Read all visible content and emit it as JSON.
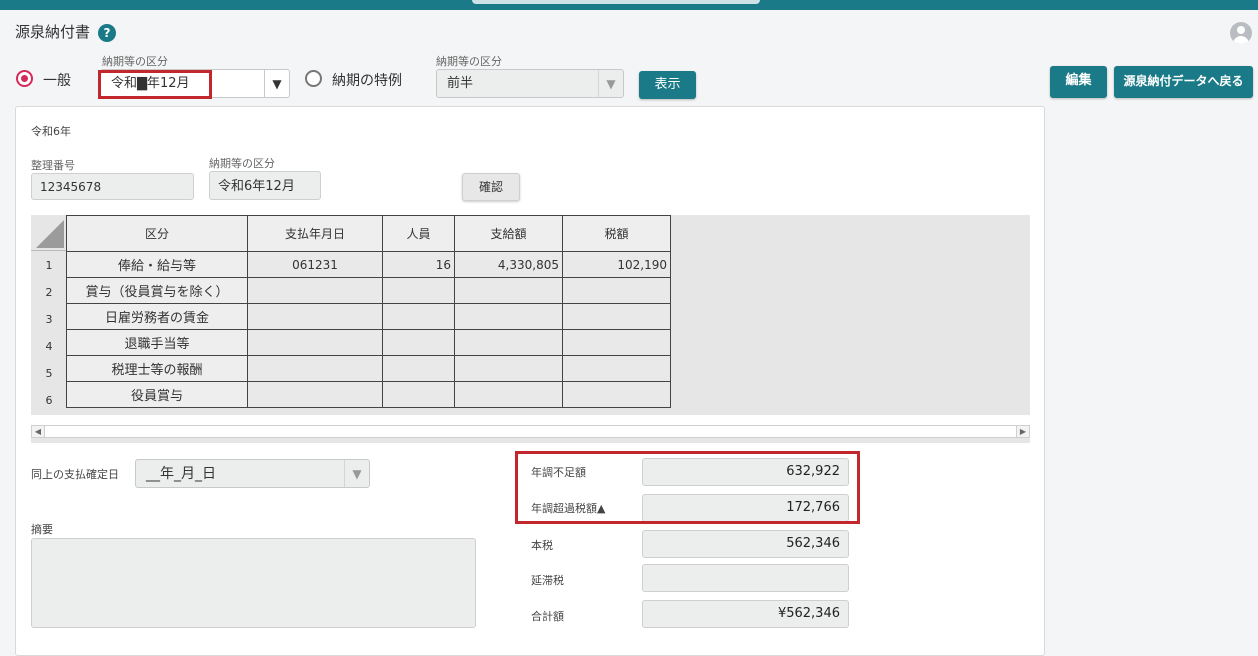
{
  "header": {
    "title": "源泉納付書",
    "help_symbol": "?",
    "user_icon": "user-avatar-icon"
  },
  "filter": {
    "period_label": "納期等の区分",
    "general_label": "一般",
    "general_selected": true,
    "period_value": "令和▇年12月",
    "special_label": "納期の特例",
    "special_selected": false,
    "special_period_label": "納期等の区分",
    "special_period_value": "前半",
    "show_button": "表示"
  },
  "actions": {
    "edit_button": "編集",
    "back_button": "源泉納付データへ戻る"
  },
  "form": {
    "year_heading": "令和6年",
    "ref_label": "整理番号",
    "ref_value": "12345678",
    "period_label": "納期等の区分",
    "period_value": "令和6年12月",
    "confirm_button": "確認"
  },
  "table": {
    "headers": [
      "区分",
      "支払年月日",
      "人員",
      "支給額",
      "税額"
    ],
    "rows": [
      {
        "no": "1",
        "category": "俸給・給与等",
        "date": "061231",
        "people": "16",
        "amount": "4,330,805",
        "tax": "102,190"
      },
      {
        "no": "2",
        "category": "賞与（役員賞与を除く）",
        "date": "",
        "people": "",
        "amount": "",
        "tax": ""
      },
      {
        "no": "3",
        "category": "日雇労務者の賃金",
        "date": "",
        "people": "",
        "amount": "",
        "tax": ""
      },
      {
        "no": "4",
        "category": "退職手当等",
        "date": "",
        "people": "",
        "amount": "",
        "tax": ""
      },
      {
        "no": "5",
        "category": "税理士等の報酬",
        "date": "",
        "people": "",
        "amount": "",
        "tax": ""
      },
      {
        "no": "6",
        "category": "役員賞与",
        "date": "",
        "people": "",
        "amount": "",
        "tax": ""
      }
    ]
  },
  "bottom": {
    "pay_date_label": "同上の支払確定日",
    "pay_date_value": "__年_月_日",
    "memo_label": "摘要",
    "shortage_label": "年調不足額",
    "shortage_value": "632,922",
    "excess_label": "年調超過税額▲",
    "excess_value": "172,766",
    "main_tax_label": "本税",
    "main_tax_value": "562,346",
    "delinquent_label": "延滞税",
    "delinquent_value": "",
    "total_label": "合計額",
    "total_value": "¥562,346"
  },
  "colors": {
    "accent": "#1a7a87",
    "radio_on": "#d42a5a",
    "highlight_box": "#c1272d"
  }
}
